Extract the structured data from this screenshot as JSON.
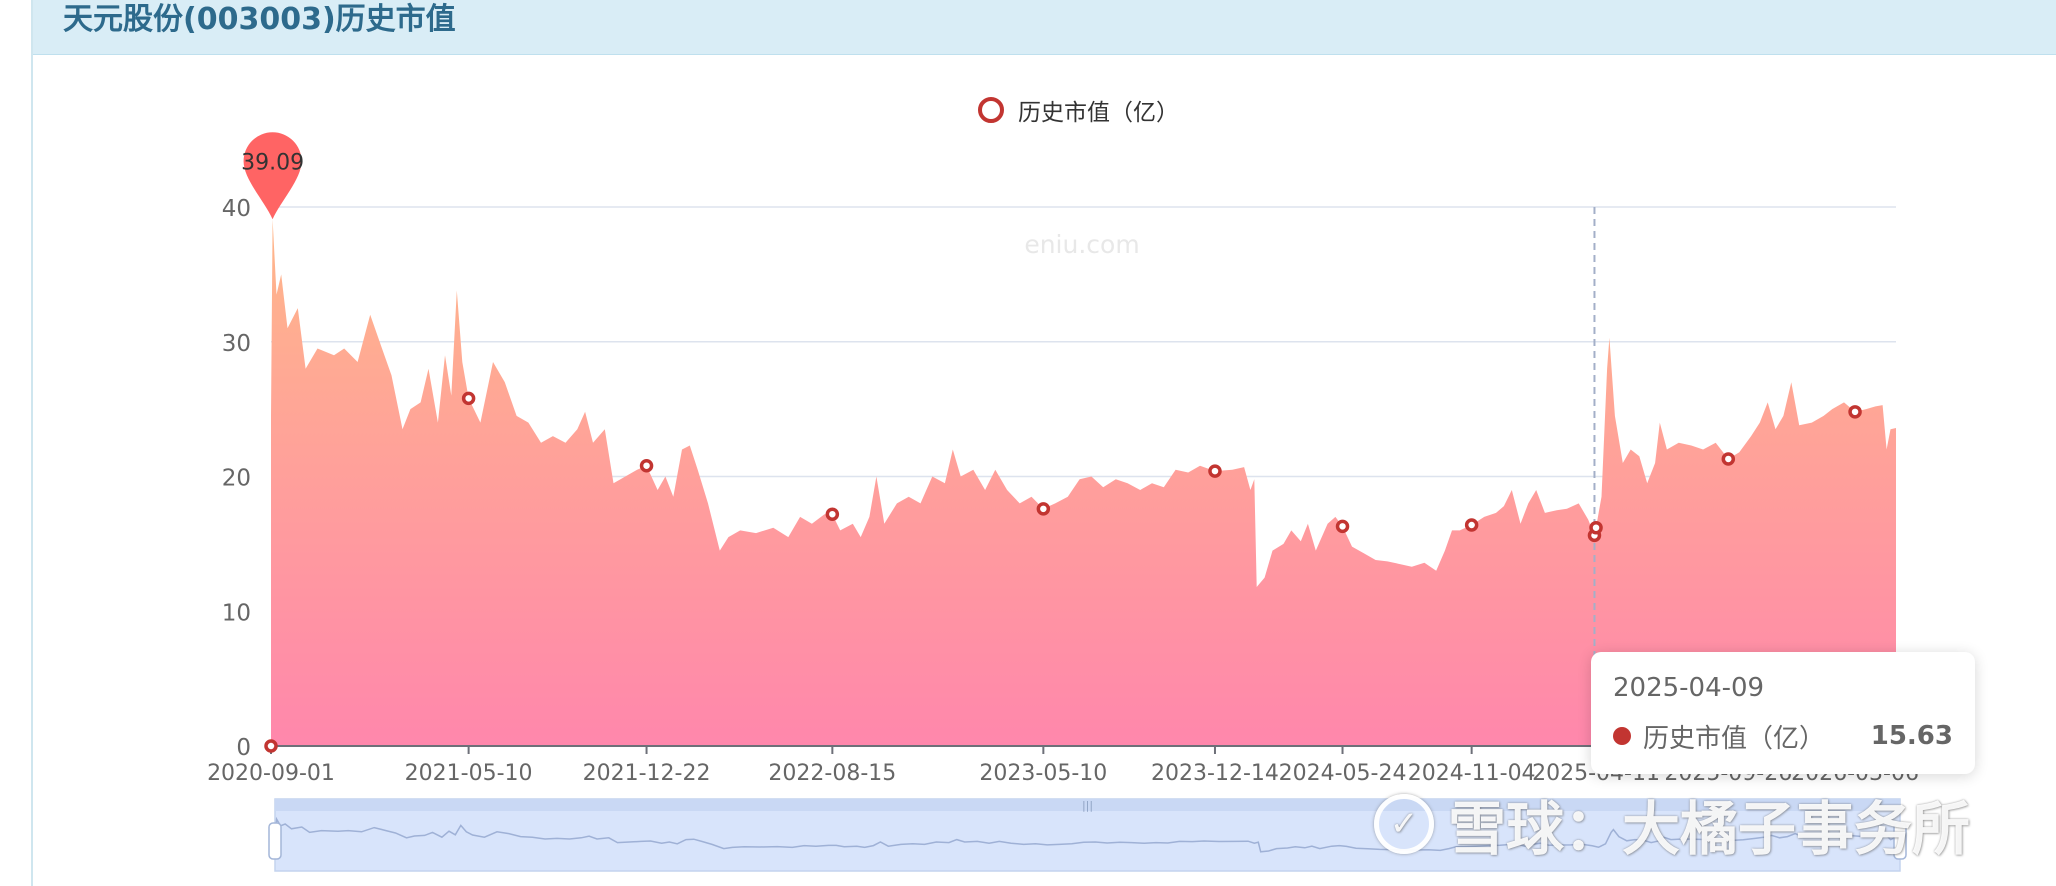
{
  "page": {
    "title": "天元股份(003003)历史市值"
  },
  "colors": {
    "accent": "#c23531",
    "header_bg": "#d9edf6",
    "header_text": "#2d6a8c",
    "area_top": "#ffb78a",
    "area_bottom": "#ff87ac",
    "marker": "#ff6464"
  },
  "chart_data": {
    "type": "area",
    "legend": {
      "label": "历史市值（亿）",
      "placement": "top-center"
    },
    "watermark": "eniu.com",
    "ylim": [
      0,
      40
    ],
    "yticks": [
      0,
      10,
      20,
      30,
      40
    ],
    "grid": true,
    "xrange": [
      "2020-09-01",
      "2026-04-27"
    ],
    "xticks": [
      "2020-09-01",
      "2021-05-10",
      "2021-12-22",
      "2022-08-15",
      "2023-05-10",
      "2023-12-14",
      "2024-05-24",
      "2024-11-04",
      "2025-04-11",
      "2025-09-26",
      "2026-03-06"
    ],
    "series": [
      {
        "name": "历史市值（亿）",
        "points": [
          [
            "2020-09-01",
            24.5
          ],
          [
            "2020-09-03",
            39.09
          ],
          [
            "2020-09-08",
            33.5
          ],
          [
            "2020-09-14",
            35.0
          ],
          [
            "2020-09-22",
            31.0
          ],
          [
            "2020-10-05",
            32.5
          ],
          [
            "2020-10-15",
            28.0
          ],
          [
            "2020-10-30",
            29.5
          ],
          [
            "2020-11-20",
            29.0
          ],
          [
            "2020-12-03",
            29.5
          ],
          [
            "2020-12-20",
            28.5
          ],
          [
            "2021-01-05",
            32.0
          ],
          [
            "2021-01-20",
            29.5
          ],
          [
            "2021-02-01",
            27.5
          ],
          [
            "2021-02-15",
            23.5
          ],
          [
            "2021-02-25",
            25.0
          ],
          [
            "2021-03-10",
            25.5
          ],
          [
            "2021-03-20",
            28.0
          ],
          [
            "2021-04-01",
            24.0
          ],
          [
            "2021-04-10",
            29.0
          ],
          [
            "2021-04-18",
            26.0
          ],
          [
            "2021-04-25",
            33.8
          ],
          [
            "2021-05-02",
            28.5
          ],
          [
            "2021-05-10",
            25.8
          ],
          [
            "2021-05-25",
            24.0
          ],
          [
            "2021-06-10",
            28.5
          ],
          [
            "2021-06-25",
            27.0
          ],
          [
            "2021-07-10",
            24.5
          ],
          [
            "2021-07-25",
            24.0
          ],
          [
            "2021-08-10",
            22.5
          ],
          [
            "2021-08-25",
            23.0
          ],
          [
            "2021-09-10",
            22.5
          ],
          [
            "2021-09-25",
            23.5
          ],
          [
            "2021-10-05",
            24.8
          ],
          [
            "2021-10-15",
            22.5
          ],
          [
            "2021-10-30",
            23.5
          ],
          [
            "2021-11-10",
            19.5
          ],
          [
            "2021-11-25",
            20.0
          ],
          [
            "2021-12-10",
            20.5
          ],
          [
            "2021-12-22",
            20.8
          ],
          [
            "2022-01-05",
            19.0
          ],
          [
            "2022-01-15",
            20.0
          ],
          [
            "2022-01-25",
            18.5
          ],
          [
            "2022-02-05",
            22.0
          ],
          [
            "2022-02-15",
            22.3
          ],
          [
            "2022-02-25",
            20.5
          ],
          [
            "2022-03-10",
            18.0
          ],
          [
            "2022-03-25",
            14.5
          ],
          [
            "2022-04-05",
            15.5
          ],
          [
            "2022-04-20",
            16.0
          ],
          [
            "2022-05-10",
            15.8
          ],
          [
            "2022-06-01",
            16.2
          ],
          [
            "2022-06-20",
            15.5
          ],
          [
            "2022-07-05",
            17.0
          ],
          [
            "2022-07-20",
            16.5
          ],
          [
            "2022-08-05",
            17.2
          ],
          [
            "2022-08-15",
            17.2
          ],
          [
            "2022-08-25",
            16.0
          ],
          [
            "2022-09-10",
            16.5
          ],
          [
            "2022-09-20",
            15.5
          ],
          [
            "2022-10-01",
            17.0
          ],
          [
            "2022-10-10",
            20.0
          ],
          [
            "2022-10-20",
            16.5
          ],
          [
            "2022-11-05",
            18.0
          ],
          [
            "2022-11-20",
            18.5
          ],
          [
            "2022-12-05",
            18.0
          ],
          [
            "2022-12-20",
            20.0
          ],
          [
            "2023-01-05",
            19.5
          ],
          [
            "2023-01-15",
            22.0
          ],
          [
            "2023-01-25",
            20.0
          ],
          [
            "2023-02-10",
            20.5
          ],
          [
            "2023-02-25",
            19.0
          ],
          [
            "2023-03-10",
            20.5
          ],
          [
            "2023-03-25",
            19.0
          ],
          [
            "2023-04-10",
            18.0
          ],
          [
            "2023-04-25",
            18.5
          ],
          [
            "2023-05-10",
            17.6
          ],
          [
            "2023-05-25",
            18.0
          ],
          [
            "2023-06-10",
            18.5
          ],
          [
            "2023-06-25",
            19.8
          ],
          [
            "2023-07-10",
            20.0
          ],
          [
            "2023-07-25",
            19.2
          ],
          [
            "2023-08-10",
            19.8
          ],
          [
            "2023-08-25",
            19.5
          ],
          [
            "2023-09-10",
            19.0
          ],
          [
            "2023-09-25",
            19.5
          ],
          [
            "2023-10-10",
            19.2
          ],
          [
            "2023-10-25",
            20.5
          ],
          [
            "2023-11-10",
            20.3
          ],
          [
            "2023-11-25",
            20.8
          ],
          [
            "2023-12-14",
            20.4
          ],
          [
            "2024-01-05",
            20.5
          ],
          [
            "2024-01-20",
            20.7
          ],
          [
            "2024-01-28",
            19.0
          ],
          [
            "2024-02-02",
            19.8
          ],
          [
            "2024-02-05",
            11.8
          ],
          [
            "2024-02-15",
            12.5
          ],
          [
            "2024-02-25",
            14.5
          ],
          [
            "2024-03-10",
            15.0
          ],
          [
            "2024-03-20",
            16.0
          ],
          [
            "2024-04-01",
            15.2
          ],
          [
            "2024-04-10",
            16.5
          ],
          [
            "2024-04-20",
            14.5
          ],
          [
            "2024-05-05",
            16.5
          ],
          [
            "2024-05-15",
            17.0
          ],
          [
            "2024-05-24",
            16.3
          ],
          [
            "2024-06-05",
            14.8
          ],
          [
            "2024-06-20",
            14.3
          ],
          [
            "2024-07-05",
            13.8
          ],
          [
            "2024-07-20",
            13.7
          ],
          [
            "2024-08-05",
            13.5
          ],
          [
            "2024-08-20",
            13.3
          ],
          [
            "2024-09-05",
            13.6
          ],
          [
            "2024-09-20",
            13.0
          ],
          [
            "2024-10-01",
            14.5
          ],
          [
            "2024-10-10",
            16.0
          ],
          [
            "2024-10-20",
            16.0
          ],
          [
            "2024-11-04",
            16.4
          ],
          [
            "2024-11-20",
            17.0
          ],
          [
            "2024-12-05",
            17.3
          ],
          [
            "2024-12-15",
            17.8
          ],
          [
            "2024-12-25",
            19.0
          ],
          [
            "2025-01-05",
            16.5
          ],
          [
            "2025-01-15",
            18.0
          ],
          [
            "2025-01-25",
            19.0
          ],
          [
            "2025-02-05",
            17.3
          ],
          [
            "2025-02-20",
            17.5
          ],
          [
            "2025-03-05",
            17.6
          ],
          [
            "2025-03-20",
            18.0
          ],
          [
            "2025-04-01",
            16.8
          ],
          [
            "2025-04-09",
            15.63
          ],
          [
            "2025-04-11",
            16.2
          ],
          [
            "2025-04-18",
            18.5
          ],
          [
            "2025-04-25",
            28.0
          ],
          [
            "2025-04-28",
            30.3
          ],
          [
            "2025-05-05",
            24.5
          ],
          [
            "2025-05-15",
            21.0
          ],
          [
            "2025-05-25",
            22.0
          ],
          [
            "2025-06-05",
            21.5
          ],
          [
            "2025-06-15",
            19.5
          ],
          [
            "2025-06-25",
            21.0
          ],
          [
            "2025-07-01",
            24.0
          ],
          [
            "2025-07-10",
            22.0
          ],
          [
            "2025-07-25",
            22.5
          ],
          [
            "2025-08-10",
            22.3
          ],
          [
            "2025-08-25",
            22.0
          ],
          [
            "2025-09-10",
            22.5
          ],
          [
            "2025-09-26",
            21.3
          ],
          [
            "2025-10-10",
            21.8
          ],
          [
            "2025-10-25",
            23.0
          ],
          [
            "2025-11-05",
            24.0
          ],
          [
            "2025-11-15",
            25.5
          ],
          [
            "2025-11-25",
            23.5
          ],
          [
            "2025-12-05",
            24.5
          ],
          [
            "2025-12-15",
            27.0
          ],
          [
            "2025-12-25",
            23.8
          ],
          [
            "2026-01-10",
            24.0
          ],
          [
            "2026-01-25",
            24.5
          ],
          [
            "2026-02-05",
            25.0
          ],
          [
            "2026-02-20",
            25.5
          ],
          [
            "2026-03-06",
            24.8
          ],
          [
            "2026-03-20",
            25.0
          ],
          [
            "2026-04-01",
            25.2
          ],
          [
            "2026-04-10",
            25.3
          ],
          [
            "2026-04-15",
            22.0
          ],
          [
            "2026-04-20",
            23.5
          ],
          [
            "2026-04-27",
            23.6
          ]
        ],
        "markers": [
          [
            "2020-09-01",
            0
          ],
          [
            "2021-05-10",
            25.8
          ],
          [
            "2021-12-22",
            20.8
          ],
          [
            "2022-08-15",
            17.2
          ],
          [
            "2023-05-10",
            17.6
          ],
          [
            "2023-12-14",
            20.4
          ],
          [
            "2024-05-24",
            16.3
          ],
          [
            "2024-11-04",
            16.4
          ],
          [
            "2025-04-09",
            15.63
          ],
          [
            "2025-04-11",
            16.2
          ],
          [
            "2025-09-26",
            21.3
          ],
          [
            "2026-03-06",
            24.8
          ]
        ]
      }
    ],
    "max_point": {
      "date": "2020-09-03",
      "value": 39.09,
      "label": "39.09"
    },
    "crosshair_date": "2025-04-09"
  },
  "tooltip": {
    "date": "2025-04-09",
    "series": "历史市值（亿）",
    "value": "15.63"
  },
  "brand": {
    "logo_glyph": "✓",
    "text": "雪球：大橘子事务所"
  }
}
